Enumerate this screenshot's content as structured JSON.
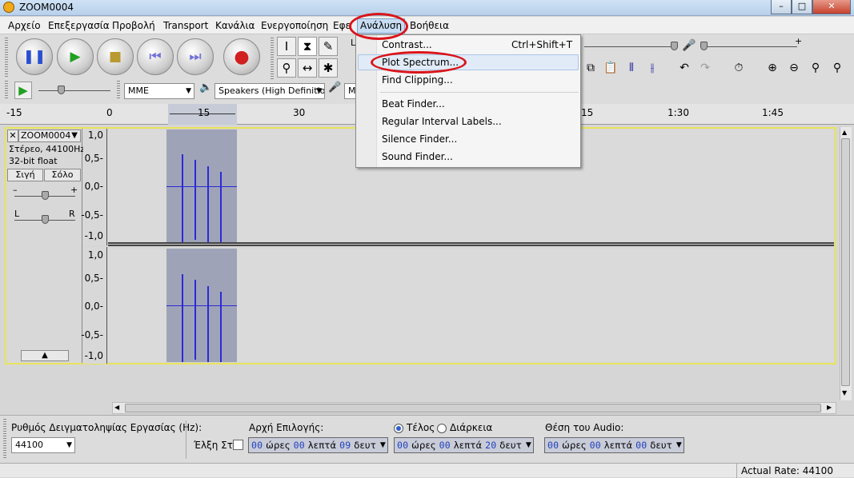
{
  "window": {
    "title": "ZOOM0004",
    "controls": [
      "–",
      "□",
      "✕"
    ]
  },
  "menubar": {
    "items": [
      "Αρχείο",
      "Επεξεργασία",
      "Προβολή",
      "Transport",
      "Κανάλια",
      "Ενεργοποίηση",
      "Εφε",
      "Ανάλυση",
      "Βοήθεια"
    ]
  },
  "analysis_menu": {
    "items": [
      {
        "label": "Contrast...",
        "shortcut": "Ctrl+Shift+T"
      },
      {
        "label": "Plot Spectrum...",
        "shortcut": ""
      },
      {
        "label": "Find Clipping...",
        "shortcut": ""
      },
      {
        "label": "Beat Finder...",
        "shortcut": ""
      },
      {
        "label": "Regular Interval Labels...",
        "shortcut": ""
      },
      {
        "label": "Silence Finder...",
        "shortcut": ""
      },
      {
        "label": "Sound Finder...",
        "shortcut": ""
      }
    ],
    "highlighted": "Plot Spectrum..."
  },
  "device_toolbar": {
    "host": "MME",
    "output": "Speakers (High Definitio",
    "input_partial": "M"
  },
  "ruler": {
    "ticks": [
      "-15",
      "0",
      "15",
      "30",
      "15",
      "1:30",
      "1:45"
    ]
  },
  "track": {
    "name": "ZOOM0004",
    "close": "✕",
    "menu_arrow": "▼",
    "info_line1": "Στέρεο, 44100Hz",
    "info_line2": "32-bit float",
    "mute_label": "Σιγή",
    "solo_label": "Σόλο",
    "gain_minus": "–",
    "gain_plus": "+",
    "pan_left": "L",
    "pan_right": "R",
    "collapse": "▲",
    "scale": [
      "1,0",
      "0,5-",
      "0,0-",
      "-0,5-",
      "-1,0"
    ]
  },
  "bottom": {
    "rate_label": "Ρυθμός Δειγματοληψίας Εργασίας (Hz):",
    "rate_value": "44100",
    "snap_label": "Έλξη Στο",
    "sel_start_label": "Αρχή Επιλογής:",
    "end_label": "Τέλος",
    "length_label": "Διάρκεια",
    "audio_pos_label": "Θέση του Audio:",
    "sel_start": {
      "h": "00",
      "hl": "ώρες",
      "m": "00",
      "ml": "λεπτά",
      "s": "09",
      "sl": "δευτ"
    },
    "sel_end": {
      "h": "00",
      "hl": "ώρες",
      "m": "00",
      "ml": "λεπτά",
      "s": "20",
      "sl": "δευτ"
    },
    "audio_pos": {
      "h": "00",
      "hl": "ώρες",
      "m": "00",
      "ml": "λεπτά",
      "s": "00",
      "sl": "δευτ"
    }
  },
  "status": {
    "actual_rate": "Actual Rate: 44100"
  }
}
